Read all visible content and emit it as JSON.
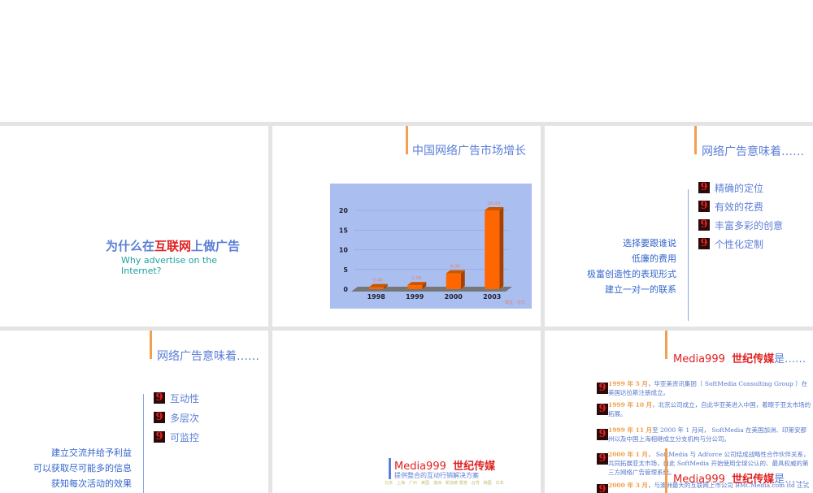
{
  "slide1": {
    "title_a": "为什么在",
    "title_b": "互联网",
    "title_c": "上做广告",
    "subtitle": "Why advertise on the Internet?"
  },
  "slide2": {
    "title": "中国网络广告市场增长"
  },
  "chart_data": {
    "type": "bar",
    "title": "中国网络广告市场增长",
    "categories": [
      "1998",
      "1999",
      "2000",
      "2003"
    ],
    "values": [
      0.48,
      1.0,
      4.0,
      20.0
    ],
    "value_labels": [
      "0.48",
      "1.00",
      "4.00",
      "20.00"
    ],
    "yticks": [
      "0",
      "5",
      "10",
      "15",
      "20"
    ],
    "ylim": [
      0,
      20
    ],
    "unit_note": "单位：亿元",
    "colors": {
      "bar": "#ff6600",
      "bg": "#aabff0"
    }
  },
  "slide3": {
    "title": "网络广告意味着……",
    "items": [
      "精确的定位",
      "有效的花费",
      "丰富多彩的创意",
      "个性化定制"
    ],
    "right_items": [
      "选择要跟谁说",
      "低廉的费用",
      "极富创造性的表现形式",
      "建立一对一的联系"
    ]
  },
  "slide4": {
    "title": "网络广告意味着……",
    "items": [
      "互动性",
      "多层次",
      "可监控"
    ],
    "right_items": [
      "建立交流并给予利益",
      "可以获取尽可能多的信息",
      "获知每次活动的效果"
    ]
  },
  "slide5": {
    "brand_a": "Media999",
    "brand_b": "世纪传媒",
    "tagline": "提供整合的互动行销解决方案",
    "cities": "北京　上海　广州　美国　澳洲　新加坡 香港　台湾　韩国　日本"
  },
  "slide6": {
    "title_a": "Media999",
    "title_b": "世纪传媒",
    "title_c": "是……",
    "history": [
      {
        "date": "1999 年 5 月",
        "text": "，华亚美资讯集团（ SoftMedia Consulting Group ）在美国达拉斯注册成立。"
      },
      {
        "date": "1999 年 10 月",
        "text": "，北京公司成立，自此华亚美进入中国，着眼于亚太市场的拓展。"
      },
      {
        "date": "1999 年 11 月",
        "text": "至 2000 年 1 月间， SoftMedia 在美国加洲、印第安那州以及中国上海相继成立分支机构与分公司。"
      },
      {
        "date": "2000 年 1 月",
        "text": "， SoftMedia 与 Adforce 公司结成战略性合作伙伴关系，共同拓展亚太市场，自此 SoftMedia 开始使用全球公认的、最具权威的第三方网络广告管理系统。"
      },
      {
        "date": "2000 年 3 月",
        "text": "，与澳洲最大的互联网上市公司 BMCMedia.com ltd 正式"
      }
    ]
  }
}
